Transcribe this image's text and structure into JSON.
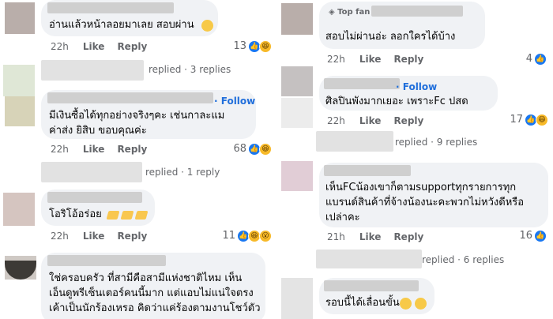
{
  "left": {
    "c1": {
      "text": "อ่านแล้วหน้าลอยมาเลย สอบผ่าน",
      "time": "22h",
      "like": "Like",
      "reply": "Reply",
      "count": "13"
    },
    "r1": {
      "text": "replied · 3 replies"
    },
    "c2": {
      "follow": "· Follow",
      "line1": "มีเงินซื้อได้ทุกอย่างจริงๆคะ เช่นกาละแม",
      "line2": "ค่าส่ง ยิสิบ ขอบคุณค่ะ",
      "time": "22h",
      "like": "Like",
      "reply": "Reply",
      "count": "68"
    },
    "r2": {
      "text": "replied · 1 reply"
    },
    "c3": {
      "text": "โอริโอ้อร่อย",
      "time": "22h",
      "like": "Like",
      "reply": "Reply",
      "count": "11"
    },
    "c4": {
      "line1": "ใช่ครอบครัว ที่สามีคือสามีแห่งชาติไหม เห็น",
      "line2": "เอ็นดูพรีเซ็นเตอร์คนนี้มาก แต่แอบไม่แน่ใจตรง",
      "line3": "เค้าเป็นนักร้องเหรอ คิดว่าแค่ร้องตามงานโชว์ตัว"
    }
  },
  "right": {
    "c1": {
      "badge": "Top fan",
      "text": "สอบไม่ผ่านอ่ะ ลอกใครได้บ้าง",
      "time": "22h",
      "like": "Like",
      "reply": "Reply",
      "count": "4"
    },
    "c2": {
      "follow": "· Follow",
      "text": "ศิลปินพังมากเยอะ เพราะFc ปสด",
      "time": "22h",
      "like": "Like",
      "reply": "Reply",
      "count": "17"
    },
    "r1": {
      "text": "replied · 9 replies"
    },
    "c3": {
      "line1": "เห็นFCน้องเขาก็ตามsupportทุกรายการทุก",
      "line2": "แบรนด์สินค้าที่จ้างน้องนะคะพวกไม่หวังดีหรือ",
      "line3": "เปล่าคะ",
      "time": "21h",
      "like": "Like",
      "reply": "Reply",
      "count": "16"
    },
    "r2": {
      "text": "replied · 6 replies"
    },
    "c4": {
      "text": "รอบนี้ได้เลื่อนขั้น"
    }
  },
  "colors": {
    "bubble": "#f0f2f5",
    "meta": "#65676b",
    "follow": "#216fdb",
    "like": "#1877f2"
  }
}
